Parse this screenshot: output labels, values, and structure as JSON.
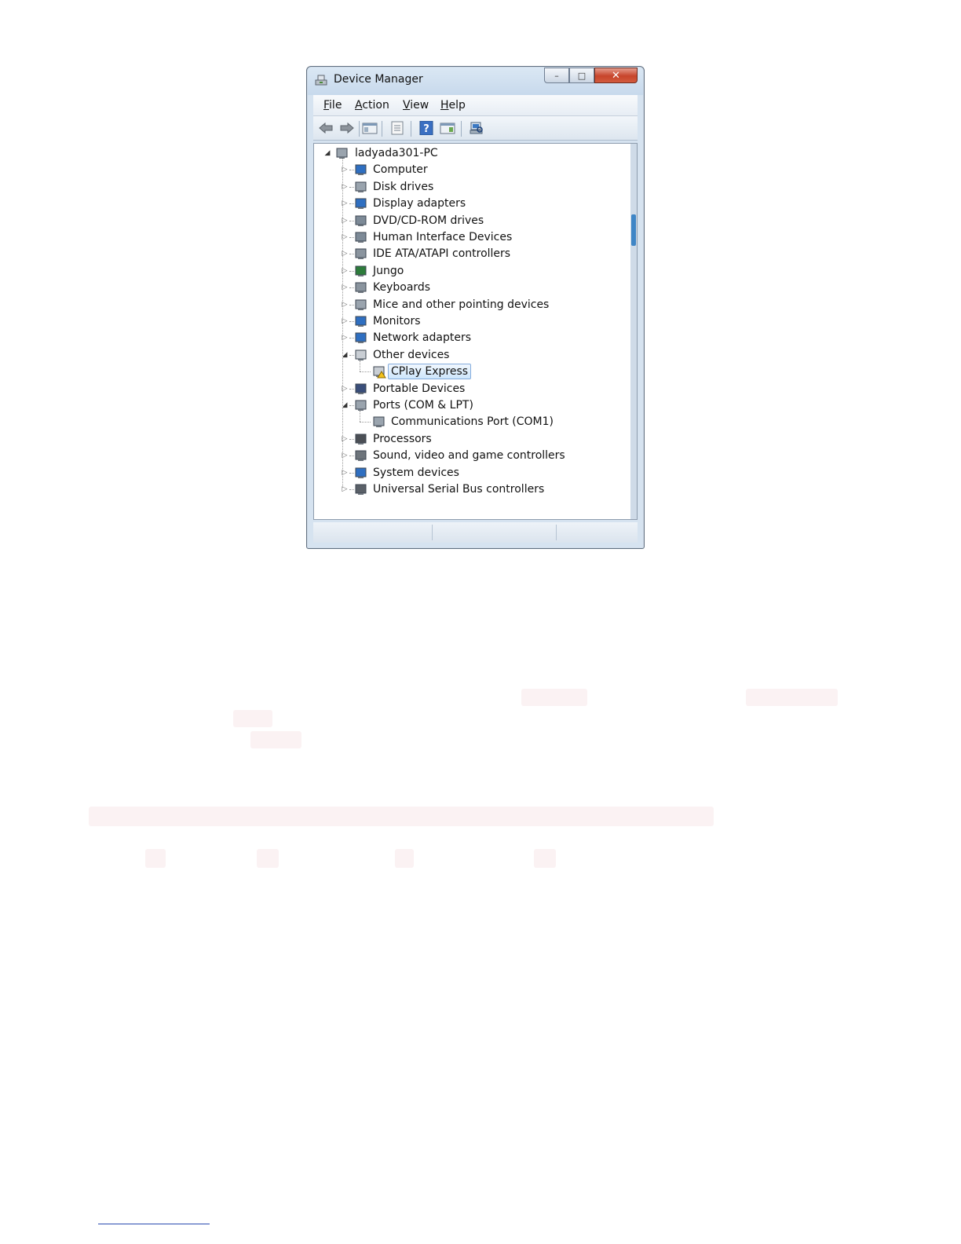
{
  "window": {
    "title": "Device Manager",
    "caption": {
      "minimize": "–",
      "maximize": "□",
      "close": "✕"
    }
  },
  "menu": [
    {
      "label": "File",
      "accel": "F",
      "rest": "ile"
    },
    {
      "label": "Action",
      "accel": "A",
      "rest": "ction"
    },
    {
      "label": "View",
      "accel": "V",
      "rest": "iew"
    },
    {
      "label": "Help",
      "accel": "H",
      "rest": "elp"
    }
  ],
  "toolbar": [
    {
      "icon": "back-arrow-icon"
    },
    {
      "icon": "forward-arrow-icon"
    },
    {
      "icon": "show-hide-console-tree-icon"
    },
    {
      "icon": "properties-icon"
    },
    {
      "icon": "help-icon"
    },
    {
      "icon": "action-pane-icon"
    },
    {
      "icon": "scan-hardware-icon"
    }
  ],
  "tree": {
    "root": "ladyada301-PC",
    "items": [
      {
        "label": "Computer",
        "expanded": false
      },
      {
        "label": "Disk drives",
        "expanded": false
      },
      {
        "label": "Display adapters",
        "expanded": false
      },
      {
        "label": "DVD/CD-ROM drives",
        "expanded": false
      },
      {
        "label": "Human Interface Devices",
        "expanded": false
      },
      {
        "label": "IDE ATA/ATAPI controllers",
        "expanded": false
      },
      {
        "label": "Jungo",
        "expanded": false
      },
      {
        "label": "Keyboards",
        "expanded": false
      },
      {
        "label": "Mice and other pointing devices",
        "expanded": false
      },
      {
        "label": "Monitors",
        "expanded": false
      },
      {
        "label": "Network adapters",
        "expanded": false
      },
      {
        "label": "Other devices",
        "expanded": true,
        "children": [
          "CPlay Express"
        ]
      },
      {
        "label": "Portable Devices",
        "expanded": false
      },
      {
        "label": "Ports (COM & LPT)",
        "expanded": true,
        "children": [
          "Communications Port (COM1)"
        ]
      },
      {
        "label": "Processors",
        "expanded": false
      },
      {
        "label": "Sound, video and game controllers",
        "expanded": false
      },
      {
        "label": "System devices",
        "expanded": false
      },
      {
        "label": "Universal Serial Bus controllers",
        "expanded": false
      }
    ],
    "selected": "CPlay Express"
  },
  "colors": {
    "selection_border": "#84acdd",
    "selection_fill": "#cde6fb",
    "close_button": "#c7442b",
    "warning": "#f3c21b"
  }
}
